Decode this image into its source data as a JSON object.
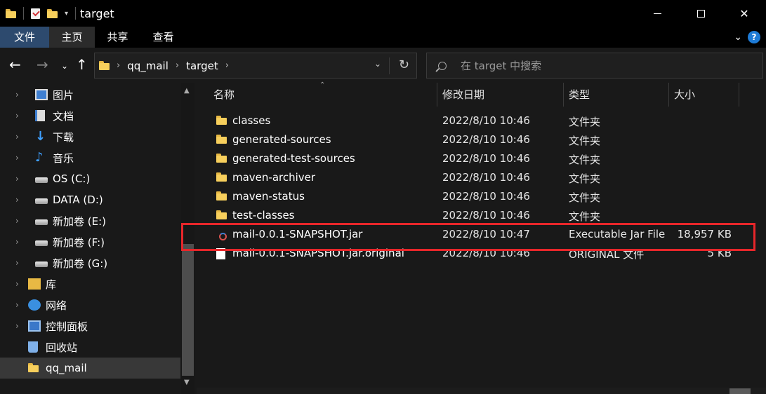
{
  "window": {
    "title": "target"
  },
  "ribbon": {
    "tabs": [
      {
        "label": "文件"
      },
      {
        "label": "主页"
      },
      {
        "label": "共享"
      },
      {
        "label": "查看"
      }
    ]
  },
  "address": {
    "crumbs": [
      "qq_mail",
      "target"
    ]
  },
  "search": {
    "placeholder": "在 target 中搜索"
  },
  "sidebar": {
    "items": [
      {
        "label": "图片",
        "icon": "pictures-icon"
      },
      {
        "label": "文档",
        "icon": "documents-icon"
      },
      {
        "label": "下载",
        "icon": "downloads-icon"
      },
      {
        "label": "音乐",
        "icon": "music-icon"
      },
      {
        "label": "OS (C:)",
        "icon": "drive-icon"
      },
      {
        "label": "DATA (D:)",
        "icon": "drive-icon"
      },
      {
        "label": "新加卷 (E:)",
        "icon": "drive-icon"
      },
      {
        "label": "新加卷 (F:)",
        "icon": "drive-icon"
      },
      {
        "label": "新加卷 (G:)",
        "icon": "drive-icon"
      },
      {
        "label": "库",
        "icon": "libraries-icon"
      },
      {
        "label": "网络",
        "icon": "network-icon"
      },
      {
        "label": "控制面板",
        "icon": "control-panel-icon"
      },
      {
        "label": "回收站",
        "icon": "recycle-bin-icon"
      },
      {
        "label": "qq_mail",
        "icon": "folder-icon"
      }
    ]
  },
  "columns": {
    "name": "名称",
    "date": "修改日期",
    "type": "类型",
    "size": "大小"
  },
  "files": [
    {
      "name": "classes",
      "date": "2022/8/10 10:46",
      "type": "文件夹",
      "size": "",
      "icon": "folder-icon"
    },
    {
      "name": "generated-sources",
      "date": "2022/8/10 10:46",
      "type": "文件夹",
      "size": "",
      "icon": "folder-icon"
    },
    {
      "name": "generated-test-sources",
      "date": "2022/8/10 10:46",
      "type": "文件夹",
      "size": "",
      "icon": "folder-icon"
    },
    {
      "name": "maven-archiver",
      "date": "2022/8/10 10:46",
      "type": "文件夹",
      "size": "",
      "icon": "folder-icon"
    },
    {
      "name": "maven-status",
      "date": "2022/8/10 10:46",
      "type": "文件夹",
      "size": "",
      "icon": "folder-icon"
    },
    {
      "name": "test-classes",
      "date": "2022/8/10 10:46",
      "type": "文件夹",
      "size": "",
      "icon": "folder-icon"
    },
    {
      "name": "mail-0.0.1-SNAPSHOT.jar",
      "date": "2022/8/10 10:47",
      "type": "Executable Jar File",
      "size": "18,957 KB",
      "icon": "jar-file-icon"
    },
    {
      "name": "mail-0.0.1-SNAPSHOT.jar.original",
      "date": "2022/8/10 10:46",
      "type": "ORIGINAL 文件",
      "size": "5 KB",
      "icon": "file-icon"
    }
  ],
  "colors": {
    "background": "#191919",
    "highlight": "#e8262a",
    "accent": "#1e7bd6"
  }
}
